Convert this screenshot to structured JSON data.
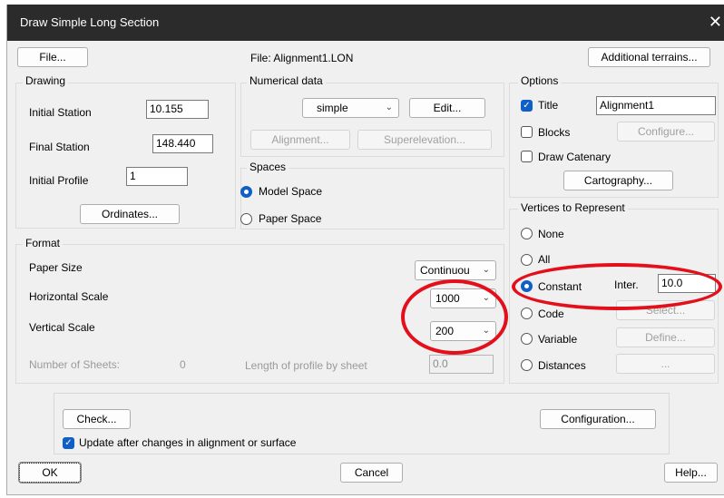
{
  "window": {
    "title": "Draw Simple Long Section",
    "close": "✕"
  },
  "top": {
    "file_button": "File...",
    "file_label": "File: Alignment1.LON",
    "additional_terrains": "Additional terrains..."
  },
  "drawing": {
    "title": "Drawing",
    "initial_station_label": "Initial Station",
    "initial_station_value": "10.155",
    "final_station_label": "Final Station",
    "final_station_value": "148.440",
    "initial_profile_label": "Initial Profile",
    "initial_profile_value": "1",
    "ordinates_button": "Ordinates..."
  },
  "numerical": {
    "title": "Numerical data",
    "select_value": "simple",
    "edit_button": "Edit...",
    "alignment_button": "Alignment...",
    "superelevation_button": "Superelevation..."
  },
  "spaces": {
    "title": "Spaces",
    "model_space": "Model Space",
    "paper_space": "Paper Space"
  },
  "format": {
    "title": "Format",
    "paper_size_label": "Paper Size",
    "paper_size_value": "Continuou",
    "horizontal_scale_label": "Horizontal Scale",
    "horizontal_scale_value": "1000",
    "vertical_scale_label": "Vertical Scale",
    "vertical_scale_value": "200",
    "sheets_label": "Number of Sheets:",
    "sheets_value": "0",
    "length_label": "Length of profile by sheet",
    "length_value": "0.0"
  },
  "options": {
    "title": "Options",
    "title_check": "Title",
    "title_value": "Alignment1",
    "blocks": "Blocks",
    "configure_button": "Configure...",
    "draw_catenary": "Draw Catenary",
    "cartography_button": "Cartography..."
  },
  "vertices": {
    "title": "Vertices to Represent",
    "none": "None",
    "all": "All",
    "constant": "Constant",
    "inter_label": "Inter.",
    "inter_value": "10.0",
    "code": "Code",
    "select_button": "Select...",
    "variable": "Variable",
    "define_button": "Define...",
    "distances": "Distances",
    "dots_button": "..."
  },
  "bottom": {
    "check_button": "Check...",
    "configuration_button": "Configuration...",
    "update_check": "Update after changes in alignment or surface",
    "ok_button": "OK",
    "cancel_button": "Cancel",
    "help_button": "Help..."
  },
  "colors": {
    "accent": "#0f5fc7",
    "annotation": "#e3101b",
    "titlebar": "#2b2b2b"
  }
}
